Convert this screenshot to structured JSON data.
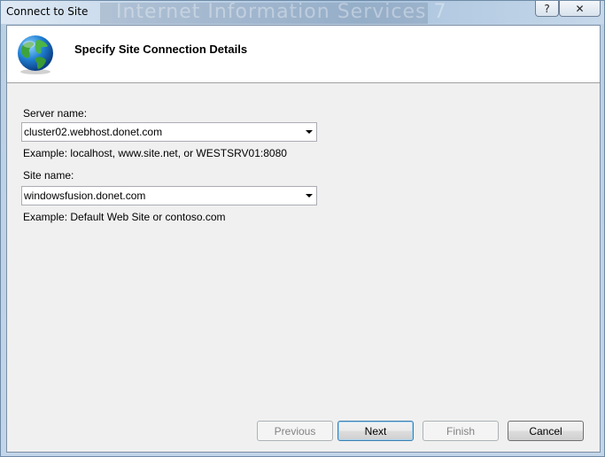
{
  "window": {
    "title": "Connect to Site",
    "background_title": "Internet Information Services 7",
    "help_label": "?",
    "close_label": "✕"
  },
  "header": {
    "icon": "globe-icon",
    "title": "Specify Site Connection Details"
  },
  "form": {
    "server_label": "Server name:",
    "server_value": "cluster02.webhost.donet.com",
    "server_example": "Example: localhost, www.site.net, or WESTSRV01:8080",
    "site_label": "Site name:",
    "site_value": "windowsfusion.donet.com",
    "site_example": "Example: Default Web Site or contoso.com"
  },
  "buttons": {
    "previous": "Previous",
    "next": "Next",
    "finish": "Finish",
    "cancel": "Cancel"
  },
  "colors": {
    "accent": "#3c7fb1",
    "client_bg": "#f0f0f0",
    "header_bg": "#ffffff"
  }
}
